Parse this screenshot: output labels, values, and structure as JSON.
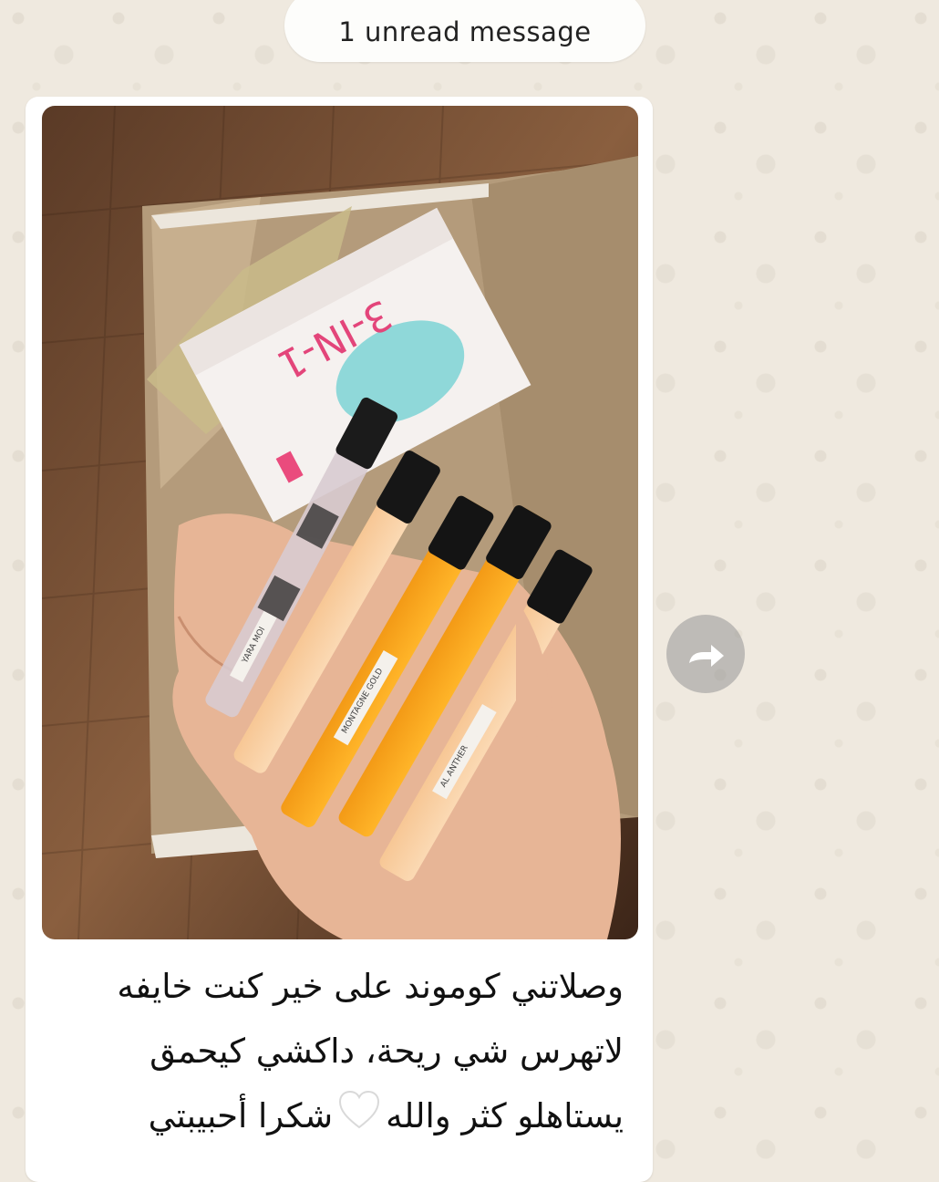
{
  "chat": {
    "unread_banner": "1 unread message",
    "message": {
      "caption_lines": [
        "وصلاتني كوموند على خير كنت خايفه",
        "لاتهرس شي ريحة، داكشي كيحمق",
        "يستاهلو كثر والله",
        "شكرا أحبيبتي"
      ],
      "emoji": "white-heart-icon"
    },
    "photo": {
      "box_label": "3-IN-1",
      "vial_labels": [
        "YARA MOI",
        "MONTAGNE GOLD",
        "AL ANTHER"
      ]
    },
    "actions": {
      "forward_icon": "forward-icon"
    }
  },
  "colors": {
    "wallpaper": "#efe9df",
    "bubble": "#ffffff",
    "forward_button": "#9a9a9a"
  }
}
